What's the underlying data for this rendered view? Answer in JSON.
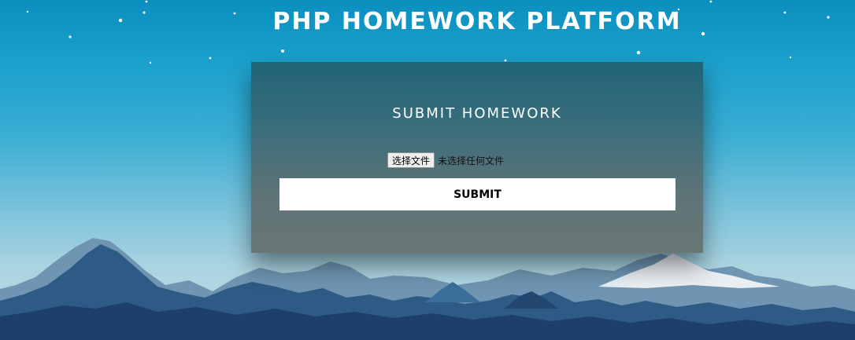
{
  "header": {
    "site_title": "PHP HOMEWORK PLATFORM"
  },
  "form": {
    "title": "SUBMIT HOMEWORK",
    "file_button_label": "选择文件",
    "file_status": "未选择任何文件",
    "submit_label": "SUBMIT"
  },
  "colors": {
    "sky_top": "#0a8fbf",
    "panel_top": "#1f6476",
    "panel_bottom": "#697676",
    "submit_bg": "#ffffff"
  },
  "icons": {
    "stars": "star-dots",
    "background": "mountain-range"
  }
}
